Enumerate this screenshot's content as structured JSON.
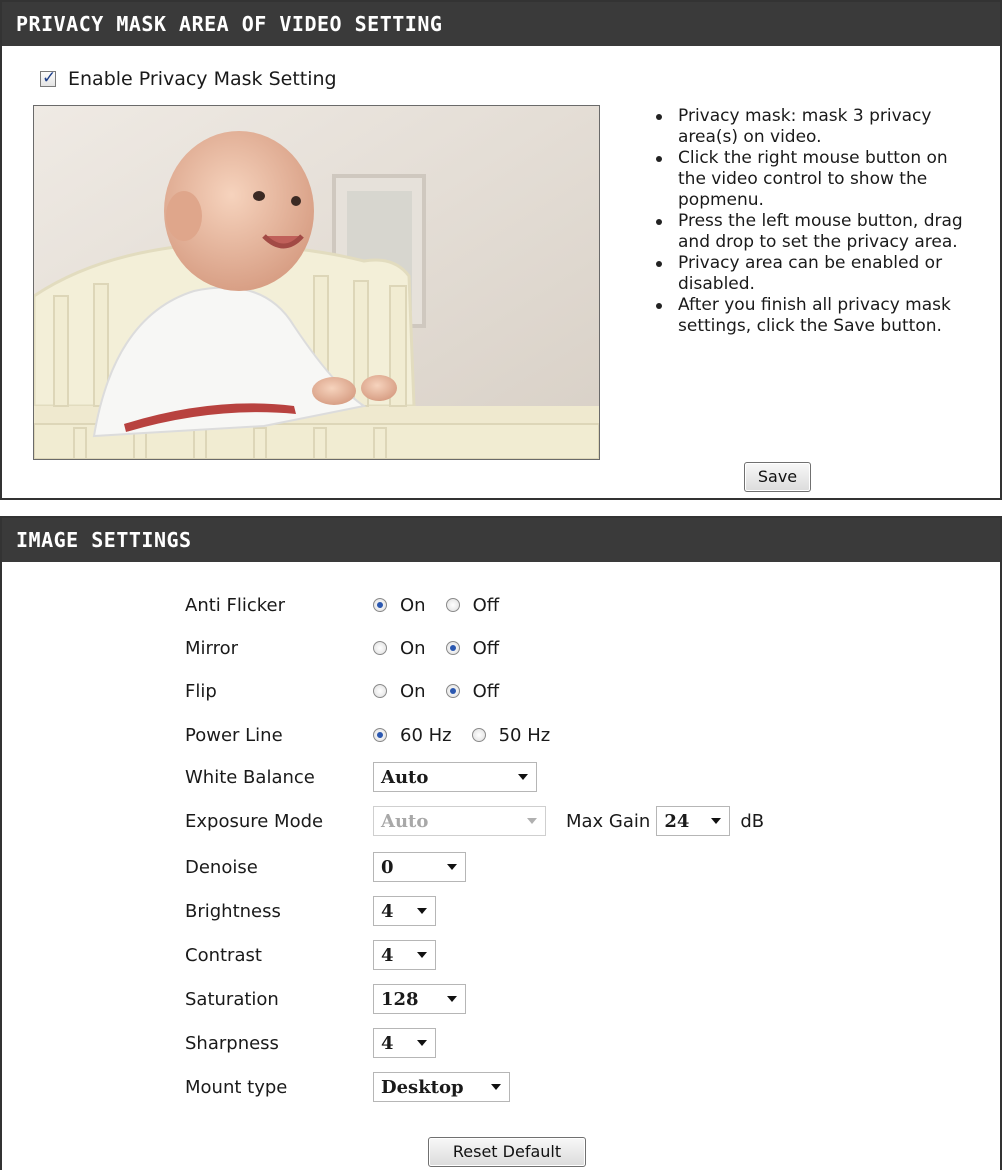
{
  "privacy": {
    "title": "PRIVACY MASK AREA OF VIDEO SETTING",
    "enable_label": "Enable Privacy Mask Setting",
    "enable_checked": true,
    "help": [
      "Privacy mask: mask 3 privacy area(s) on video.",
      "Click the right mouse button on the video control to show the popmenu.",
      "Press the left mouse button, drag and drop to set the privacy area.",
      "Privacy area can be enabled or disabled.",
      "After you finish all privacy mask settings, click the Save button."
    ],
    "save_label": "Save"
  },
  "image_settings": {
    "title": "IMAGE SETTINGS",
    "anti_flicker": {
      "label": "Anti Flicker",
      "options": [
        "On",
        "Off"
      ],
      "selected": "On"
    },
    "mirror": {
      "label": "Mirror",
      "options": [
        "On",
        "Off"
      ],
      "selected": "Off"
    },
    "flip": {
      "label": "Flip",
      "options": [
        "On",
        "Off"
      ],
      "selected": "Off"
    },
    "power_line": {
      "label": "Power Line",
      "options": [
        "60 Hz",
        "50 Hz"
      ],
      "selected": "60 Hz"
    },
    "white_balance": {
      "label": "White Balance",
      "value": "Auto"
    },
    "exposure_mode": {
      "label": "Exposure Mode",
      "value": "Auto",
      "disabled": true
    },
    "max_gain": {
      "label": "Max Gain",
      "value": "24",
      "unit": "dB"
    },
    "denoise": {
      "label": "Denoise",
      "value": "0"
    },
    "brightness": {
      "label": "Brightness",
      "value": "4"
    },
    "contrast": {
      "label": "Contrast",
      "value": "4"
    },
    "saturation": {
      "label": "Saturation",
      "value": "128"
    },
    "sharpness": {
      "label": "Sharpness",
      "value": "4"
    },
    "mount_type": {
      "label": "Mount type",
      "value": "Desktop"
    },
    "reset_label": "Reset Default"
  },
  "icons": {
    "checkbox": "checkbox-checked-icon",
    "radio": "radio-icon",
    "dropdown": "chevron-down-icon"
  },
  "colors": {
    "header_bg": "#3a3a3a",
    "header_text": "#ffffff",
    "radio_selected": "#2b58b0"
  }
}
